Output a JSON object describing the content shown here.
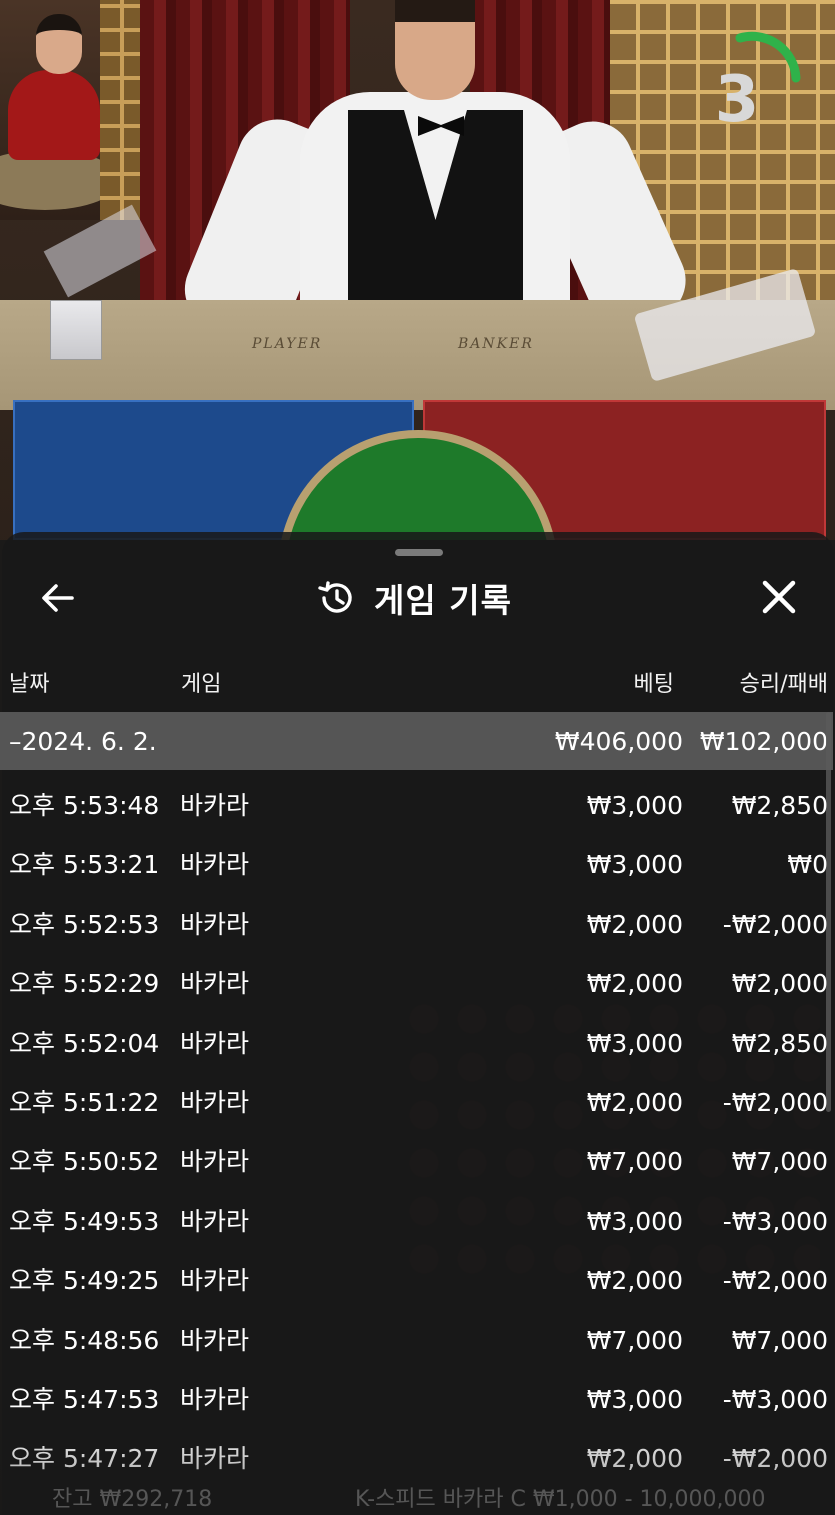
{
  "game_area": {
    "countdown": "3",
    "felt_player": "PLAYER",
    "felt_banker": "BANKER"
  },
  "history": {
    "title": "게임 기록",
    "icons": {
      "back": "arrow-left-icon",
      "history": "history-clock-icon",
      "close": "close-icon"
    },
    "columns": {
      "date": "날짜",
      "game": "게임",
      "bet": "베팅",
      "result": "승리/패배"
    },
    "date_group": {
      "label": "–2024. 6. 2.",
      "bet_total": "₩406,000",
      "result_total": "₩102,000"
    },
    "rows": [
      {
        "time": "오후 5:53:48",
        "game": "바카라",
        "bet": "₩3,000",
        "result": "₩2,850"
      },
      {
        "time": "오후 5:53:21",
        "game": "바카라",
        "bet": "₩3,000",
        "result": "₩0"
      },
      {
        "time": "오후 5:52:53",
        "game": "바카라",
        "bet": "₩2,000",
        "result": "-₩2,000"
      },
      {
        "time": "오후 5:52:29",
        "game": "바카라",
        "bet": "₩2,000",
        "result": "₩2,000"
      },
      {
        "time": "오후 5:52:04",
        "game": "바카라",
        "bet": "₩3,000",
        "result": "₩2,850"
      },
      {
        "time": "오후 5:51:22",
        "game": "바카라",
        "bet": "₩2,000",
        "result": "-₩2,000"
      },
      {
        "time": "오후 5:50:52",
        "game": "바카라",
        "bet": "₩7,000",
        "result": "₩7,000"
      },
      {
        "time": "오후 5:49:53",
        "game": "바카라",
        "bet": "₩3,000",
        "result": "-₩3,000"
      },
      {
        "time": "오후 5:49:25",
        "game": "바카라",
        "bet": "₩2,000",
        "result": "-₩2,000"
      },
      {
        "time": "오후 5:48:56",
        "game": "바카라",
        "bet": "₩7,000",
        "result": "₩7,000"
      },
      {
        "time": "오후 5:47:53",
        "game": "바카라",
        "bet": "₩3,000",
        "result": "-₩3,000"
      },
      {
        "time": "오후 5:47:27",
        "game": "바카라",
        "bet": "₩2,000",
        "result": "-₩2,000"
      }
    ]
  },
  "footer": {
    "balance": "잔고 ₩292,718",
    "table": "K-스피드 바카라 C ₩1,000 - 10,000,000"
  },
  "colors": {
    "player": "#1d4a8c",
    "banker": "#8c2222",
    "tie": "#1e7a2a",
    "timer": "#2fb24a"
  }
}
